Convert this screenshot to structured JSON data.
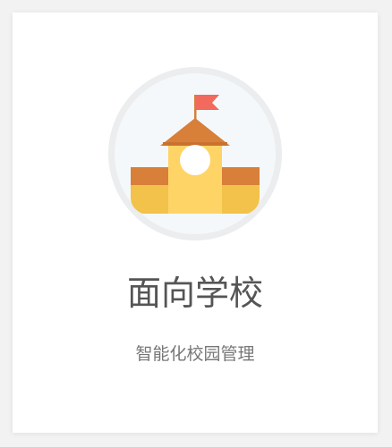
{
  "card": {
    "title": "面向学校",
    "subtitle": "智能化校园管理",
    "icon": "school-building-icon"
  },
  "colors": {
    "circle_ring": "#ebedee",
    "circle_fill": "#f5f8fa",
    "roof": "#d87f3a",
    "wall": "#ffd466",
    "wing_base": "#f3c24a",
    "flag": "#f26a5d",
    "title_text": "#555555",
    "subtitle_text": "#777777"
  }
}
